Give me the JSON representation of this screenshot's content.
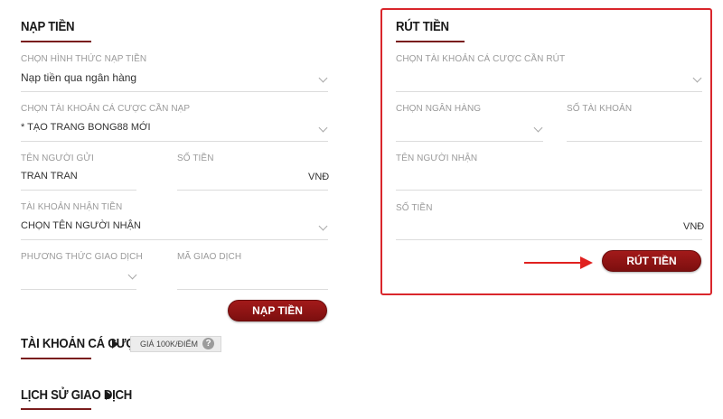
{
  "deposit": {
    "title": "NẠP TIỀN",
    "method_label": "CHỌN HÌNH THỨC NẠP TIỀN",
    "method_value": "Nạp tiền qua ngân hàng",
    "account_label": "CHỌN TÀI KHOẢN CÁ CƯỢC CẦN NẠP",
    "account_value": "* TẠO TRANG BONG88 MỚI",
    "sender_label": "TÊN NGƯỜI GỬI",
    "sender_value": "TRAN TRAN",
    "amount_label": "SỐ TIỀN",
    "amount_unit": "VNĐ",
    "receiver_account_label": "TÀI KHOẢN NHẬN TIỀN",
    "receiver_account_value": "CHỌN TÊN NGƯỜI NHẬN",
    "transaction_method_label": "PHƯƠNG THỨC GIAO DỊCH",
    "transaction_code_label": "MÃ GIAO DỊCH",
    "submit_label": "NẠP TIỀN"
  },
  "withdraw": {
    "title": "RÚT TIỀN",
    "account_label": "CHỌN TÀI KHOẢN CÁ CƯỢC CẦN RÚT",
    "bank_label": "CHỌN NGÂN HÀNG",
    "account_number_label": "SỐ TÀI KHOẢN",
    "receiver_name_label": "TÊN NGƯỜI NHẬN",
    "amount_label": "SỐ TIỀN",
    "amount_unit": "VNĐ",
    "submit_label": "RÚT TIỀN"
  },
  "betting_accounts": {
    "title": "TÀI KHOẢN CÁ CƯỢC",
    "badge_label": "GIÁ 100K/ĐIỂM",
    "help_glyph": "?"
  },
  "history": {
    "title": "LỊCH SỬ GIAO DỊCH"
  },
  "colors": {
    "accent": "#7c0f0f",
    "highlight": "#d9262c",
    "arrow": "#e0211f"
  },
  "icons": {
    "dropdown": "chevron-down-icon",
    "expand": "play-icon",
    "help": "help-icon",
    "annotation": "arrow-right-icon"
  }
}
